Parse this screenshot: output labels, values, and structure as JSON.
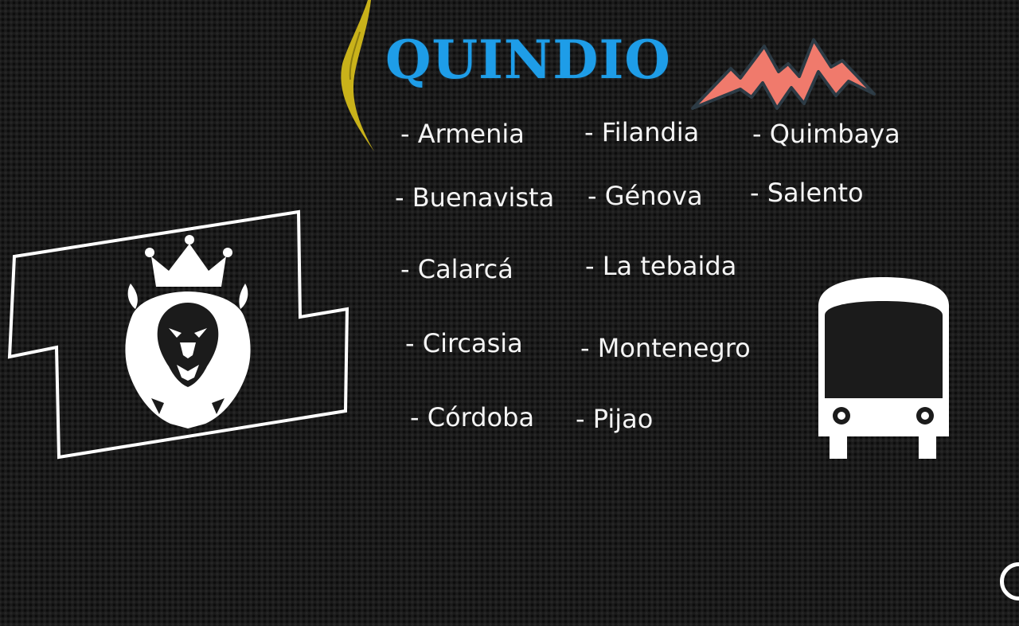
{
  "title": "QUINDIO",
  "municipalities": [
    "- Armenia",
    "- Filandia",
    "- Quimbaya",
    "- Buenavista",
    "- Génova",
    "- Salento",
    "- Calarcá",
    "- La tebaida",
    "- Circasia",
    "- Montenegro",
    "- Córdoba",
    "- Pijao"
  ],
  "colors": {
    "title": "#1e9de8",
    "leaf": "#c9b21a",
    "mountain": "#f07a6c",
    "mountain_outline": "#2d3b45",
    "text": "#f4f4f4",
    "lines": "#ffffff"
  },
  "icons": [
    "leaf-icon",
    "mountain-icon",
    "lion-crown-icon",
    "bus-icon"
  ]
}
